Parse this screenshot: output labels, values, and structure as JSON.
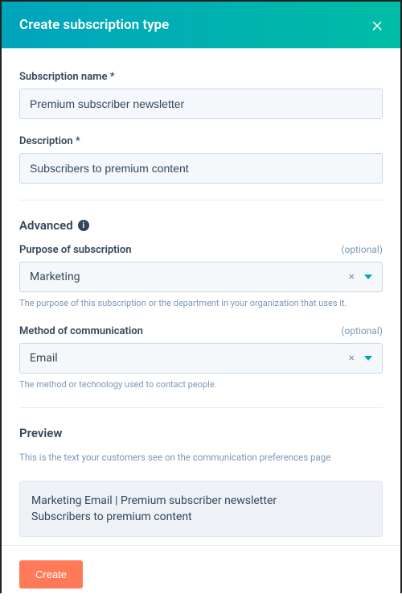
{
  "header": {
    "title": "Create subscription type"
  },
  "fields": {
    "name": {
      "label": "Subscription name *",
      "value": "Premium subscriber newsletter"
    },
    "description": {
      "label": "Description *",
      "value": "Subscribers to premium content"
    }
  },
  "advanced": {
    "title": "Advanced",
    "purpose": {
      "label": "Purpose of subscription",
      "optional": "(optional)",
      "value": "Marketing",
      "help": "The purpose of this subscription or the department in your organization that uses it."
    },
    "method": {
      "label": "Method of communication",
      "optional": "(optional)",
      "value": "Email",
      "help": "The method or technology used to contact people."
    }
  },
  "preview": {
    "title": "Preview",
    "description": "This is the text your customers see on the communication preferences page",
    "line1": "Marketing Email | Premium subscriber newsletter",
    "line2": "Subscribers to premium content"
  },
  "footer": {
    "create": "Create"
  }
}
